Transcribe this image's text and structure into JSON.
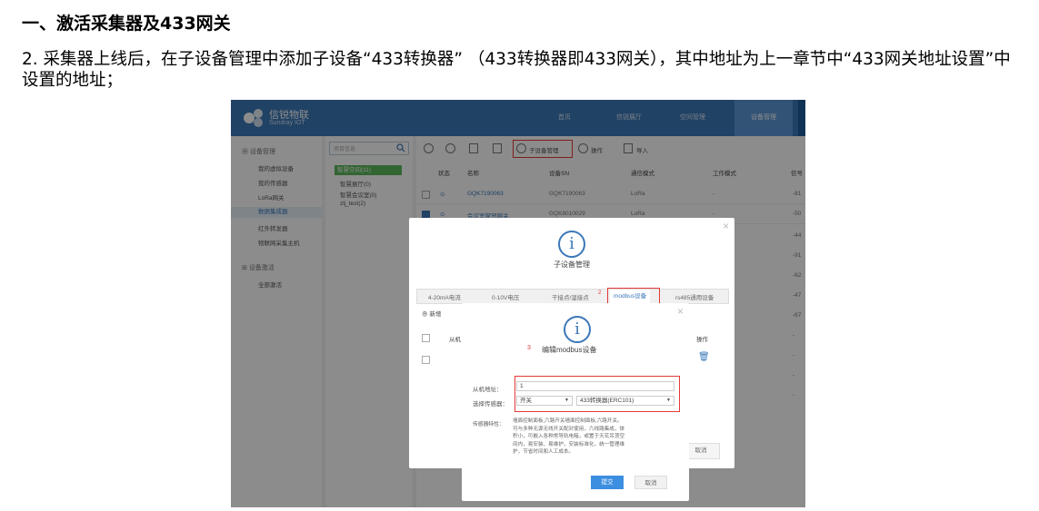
{
  "doc": {
    "heading": "一、激活采集器及433网关",
    "paragraph": "2. 采集器上线后，在子设备管理中添加子设备“433转换器” （433转换器即433网关），其中地址为上一章节中“433网关地址设置”中设置的地址；"
  },
  "app": {
    "logo_title": "信锐物联",
    "logo_subtitle": "Sundray IOT",
    "nav": [
      "首页",
      "信锐展厅",
      "空间管理",
      "设备管理"
    ],
    "sidebar": {
      "section1": "设备管理",
      "items": [
        "我的虚拟设备",
        "我的传感器",
        "LoRa网关",
        "数据集成器",
        "红外转发器",
        "物联网采集主机"
      ],
      "section2": "设备激活",
      "items2": [
        "全部激活"
      ]
    },
    "tree": {
      "search_placeholder": "项目信息",
      "selected": "智慧空间(11)",
      "nodes": [
        "智慧展厅(0)",
        "智慧会议室(0)",
        "zlj_test(2)"
      ]
    },
    "toolbar": {
      "sub_device": "子设备管理",
      "operate": "操作",
      "import": "导入"
    },
    "table": {
      "headers": [
        "状态",
        "名称",
        "设备SN",
        "通信模式",
        "工作模式",
        "信号"
      ],
      "rows": [
        {
          "name": "GQK7190063",
          "sn": "GQK7190063",
          "mode": "LoRa",
          "work": "-",
          "signal": "-81"
        },
        {
          "name": "会议室窗帘网关",
          "sn": "GQK8010029",
          "mode": "LoRa",
          "work": "-",
          "signal": "-50"
        }
      ],
      "signal_col": [
        "-44",
        "-91",
        "-62",
        "-47",
        "-67",
        "-",
        "-",
        "-",
        "-"
      ]
    },
    "modal1": {
      "title": "子设备管理",
      "tabs": [
        "4-20mA电流",
        "0-10V电压",
        "干接点/湿接点",
        "modbus设备",
        "rs485通用设备"
      ],
      "add": "新增",
      "col_slave": "从机",
      "col_op": "操作",
      "cancel": "取消"
    },
    "modal2": {
      "step": "3",
      "title": "编辑modbus设备",
      "slave_label": "从机地址：",
      "slave_value": "1",
      "sensor_label": "选择传感器：",
      "sensor_type": "开关",
      "sensor_model": "433转换器(ERC101)",
      "desc_label": "传感器特性：",
      "desc": "墙面控制面板,六路开关墙面控制面板,六路开关。可与多种无源无线开关配对使用，六线路集成，体积小，可嵌入各种常导轨电箱，或置于天花吊顶空间内，易安装、易维护，安装标准化，统一管理维护，节省时间和人工成本。",
      "submit": "提交",
      "cancel": "取消"
    }
  }
}
